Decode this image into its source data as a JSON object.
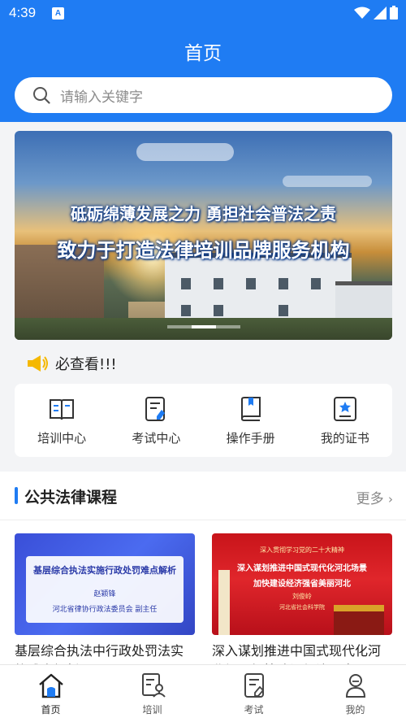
{
  "status_bar": {
    "time": "4:39",
    "notification_icon": "A"
  },
  "header": {
    "title": "首页",
    "search_placeholder": "请输入关键字"
  },
  "banner": {
    "line1": "砥砺绵薄发展之力  勇担社会普法之责",
    "line2": "致力于打造法律培训品牌服务机构",
    "slide_count": 3,
    "active_slide": 2
  },
  "notice": {
    "text": "必查看!!!"
  },
  "quick_links": [
    {
      "label": "培训中心",
      "icon": "book-open-icon"
    },
    {
      "label": "考试中心",
      "icon": "exam-paper-icon"
    },
    {
      "label": "操作手册",
      "icon": "manual-icon"
    },
    {
      "label": "我的证书",
      "icon": "certificate-icon"
    }
  ],
  "courses": {
    "title": "公共法律课程",
    "more": "更多",
    "items": [
      {
        "title": "基层综合执法中行政处罚法实施难点解析",
        "thumb_title": "基层综合执法实施行政处罚难点解析",
        "thumb_speaker": "赵颖锋",
        "thumb_org": "河北省律协行政法委员会 副主任"
      },
      {
        "title": "深入谋划推进中国式现代化河北场景加快建设经济强省",
        "thumb_top": "深入贯彻学习党的二十大精神",
        "thumb_line1": "深入谋划推进中国式现代化河北场景",
        "thumb_line2": "加快建设经济强省美丽河北",
        "thumb_speaker": "刘俊岭",
        "thumb_org": "河北省社会科学院"
      }
    ]
  },
  "tabbar": [
    {
      "label": "首页",
      "icon": "home-icon",
      "active": true
    },
    {
      "label": "培训",
      "icon": "training-icon",
      "active": false
    },
    {
      "label": "考试",
      "icon": "exam-icon",
      "active": false
    },
    {
      "label": "我的",
      "icon": "profile-icon",
      "active": false
    }
  ],
  "colors": {
    "primary": "#1f7cf3",
    "page_bg": "#f3f4f6"
  }
}
